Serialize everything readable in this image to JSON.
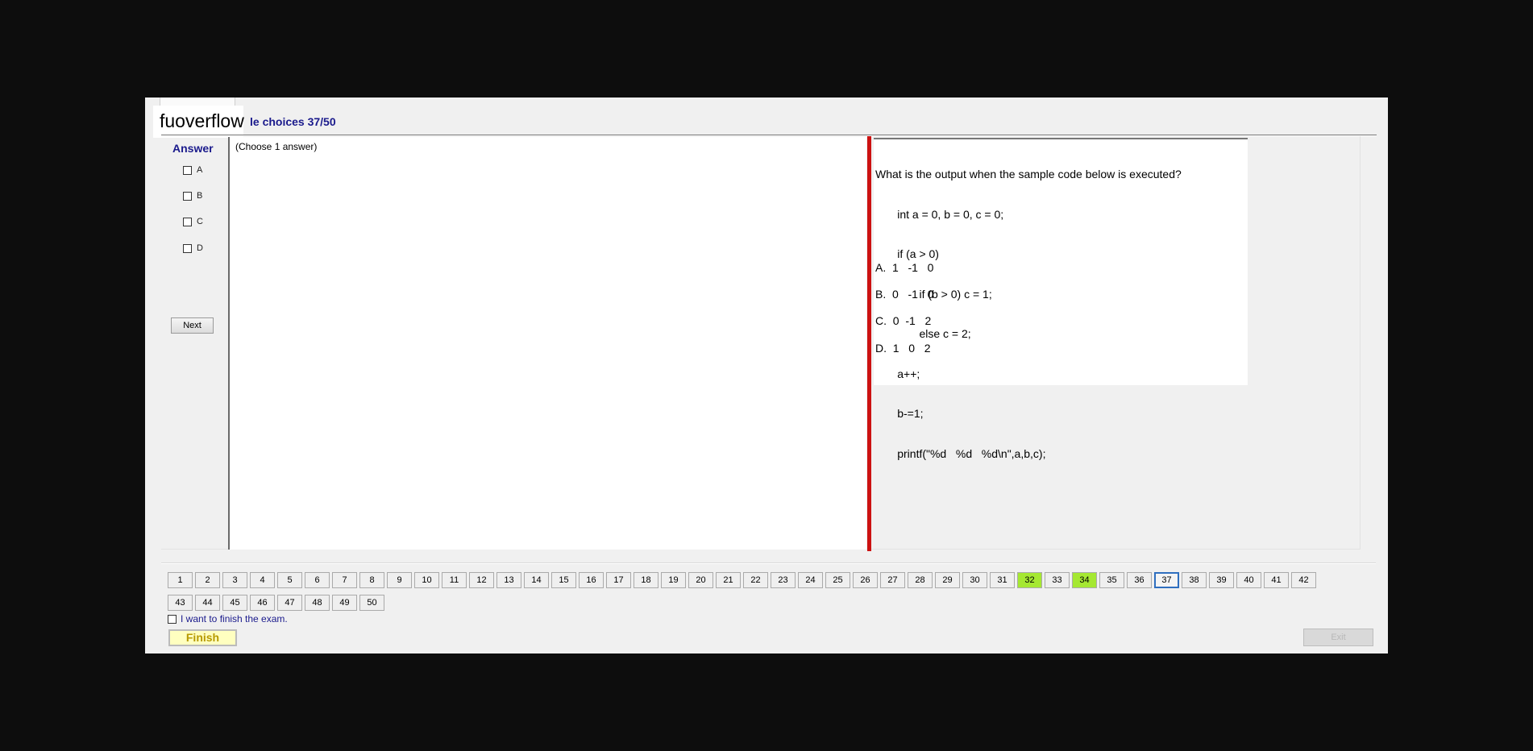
{
  "header": {
    "logo": "fuoverflow",
    "section_title": "le choices 37/50"
  },
  "answer": {
    "heading": "Answer",
    "options": [
      "A",
      "B",
      "C",
      "D"
    ],
    "next_label": "Next"
  },
  "answer_panel": {
    "hint": "(Choose 1 answer)"
  },
  "question": {
    "lines": [
      "What is the output when the sample code below is executed?",
      "       int a = 0, b = 0, c = 0;",
      "       if (a > 0)",
      "              if (b > 0) c = 1;",
      "              else c = 2;",
      "       a++;",
      "       b-=1;",
      "       printf(\"%d   %d   %d\\n\",a,b,c);"
    ],
    "options": [
      "A.  1   -1   0",
      "B.  0   -1   0",
      "C.  0  -1   2",
      "D.  1   0   2"
    ]
  },
  "navigator": {
    "total": 50,
    "current": 37,
    "answered": [
      32,
      34
    ],
    "answered_color": "#a5e832",
    "current_border_color": "#2f6fbf"
  },
  "footer": {
    "finish_check_label": "I want to finish the exam.",
    "finish_label": "Finish",
    "exit_label": "Exit"
  },
  "colors": {
    "title": "#1a1a8c",
    "splitter": "#cc1111"
  }
}
